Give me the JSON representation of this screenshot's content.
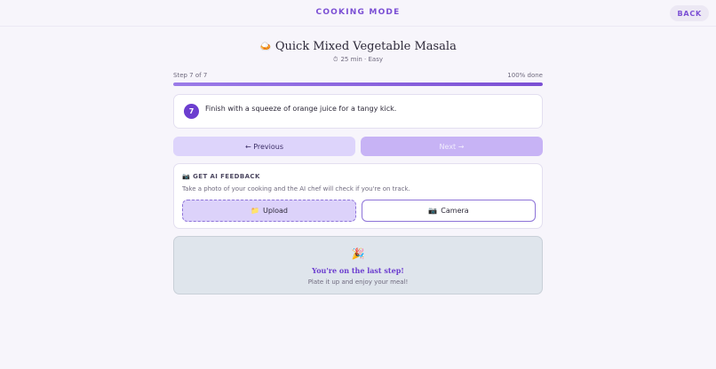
{
  "header": {
    "title": "COOKING MODE",
    "back_label": "BACK"
  },
  "recipe": {
    "icon": "🍛",
    "icon_name": "curry-icon",
    "title": "Quick Mixed Vegetable Masala",
    "timer_icon": "⏱",
    "meta": "25 min · Easy"
  },
  "progress": {
    "step_label": "Step 7 of 7",
    "done_label": "100% done",
    "fraction": 1.0
  },
  "step": {
    "number": "7",
    "text": "Finish with a squeeze of orange juice for a tangy kick."
  },
  "nav": {
    "previous_label": "← Previous",
    "next_label": "Next →"
  },
  "feedback": {
    "header_icon": "📷",
    "header": "GET AI FEEDBACK",
    "description": "Take a photo of your cooking and the AI chef will check if you're on track.",
    "upload_icon": "📁",
    "upload_label": "Upload",
    "camera_icon": "📷",
    "camera_label": "Camera"
  },
  "completion": {
    "icon": "🎉",
    "title": "You're on the last step!",
    "subtitle": "Plate it up and enjoy your meal!"
  },
  "colors": {
    "accent": "#7b4fd4",
    "step_badge": "#6c3ecf",
    "background": "#f7f5fb"
  }
}
